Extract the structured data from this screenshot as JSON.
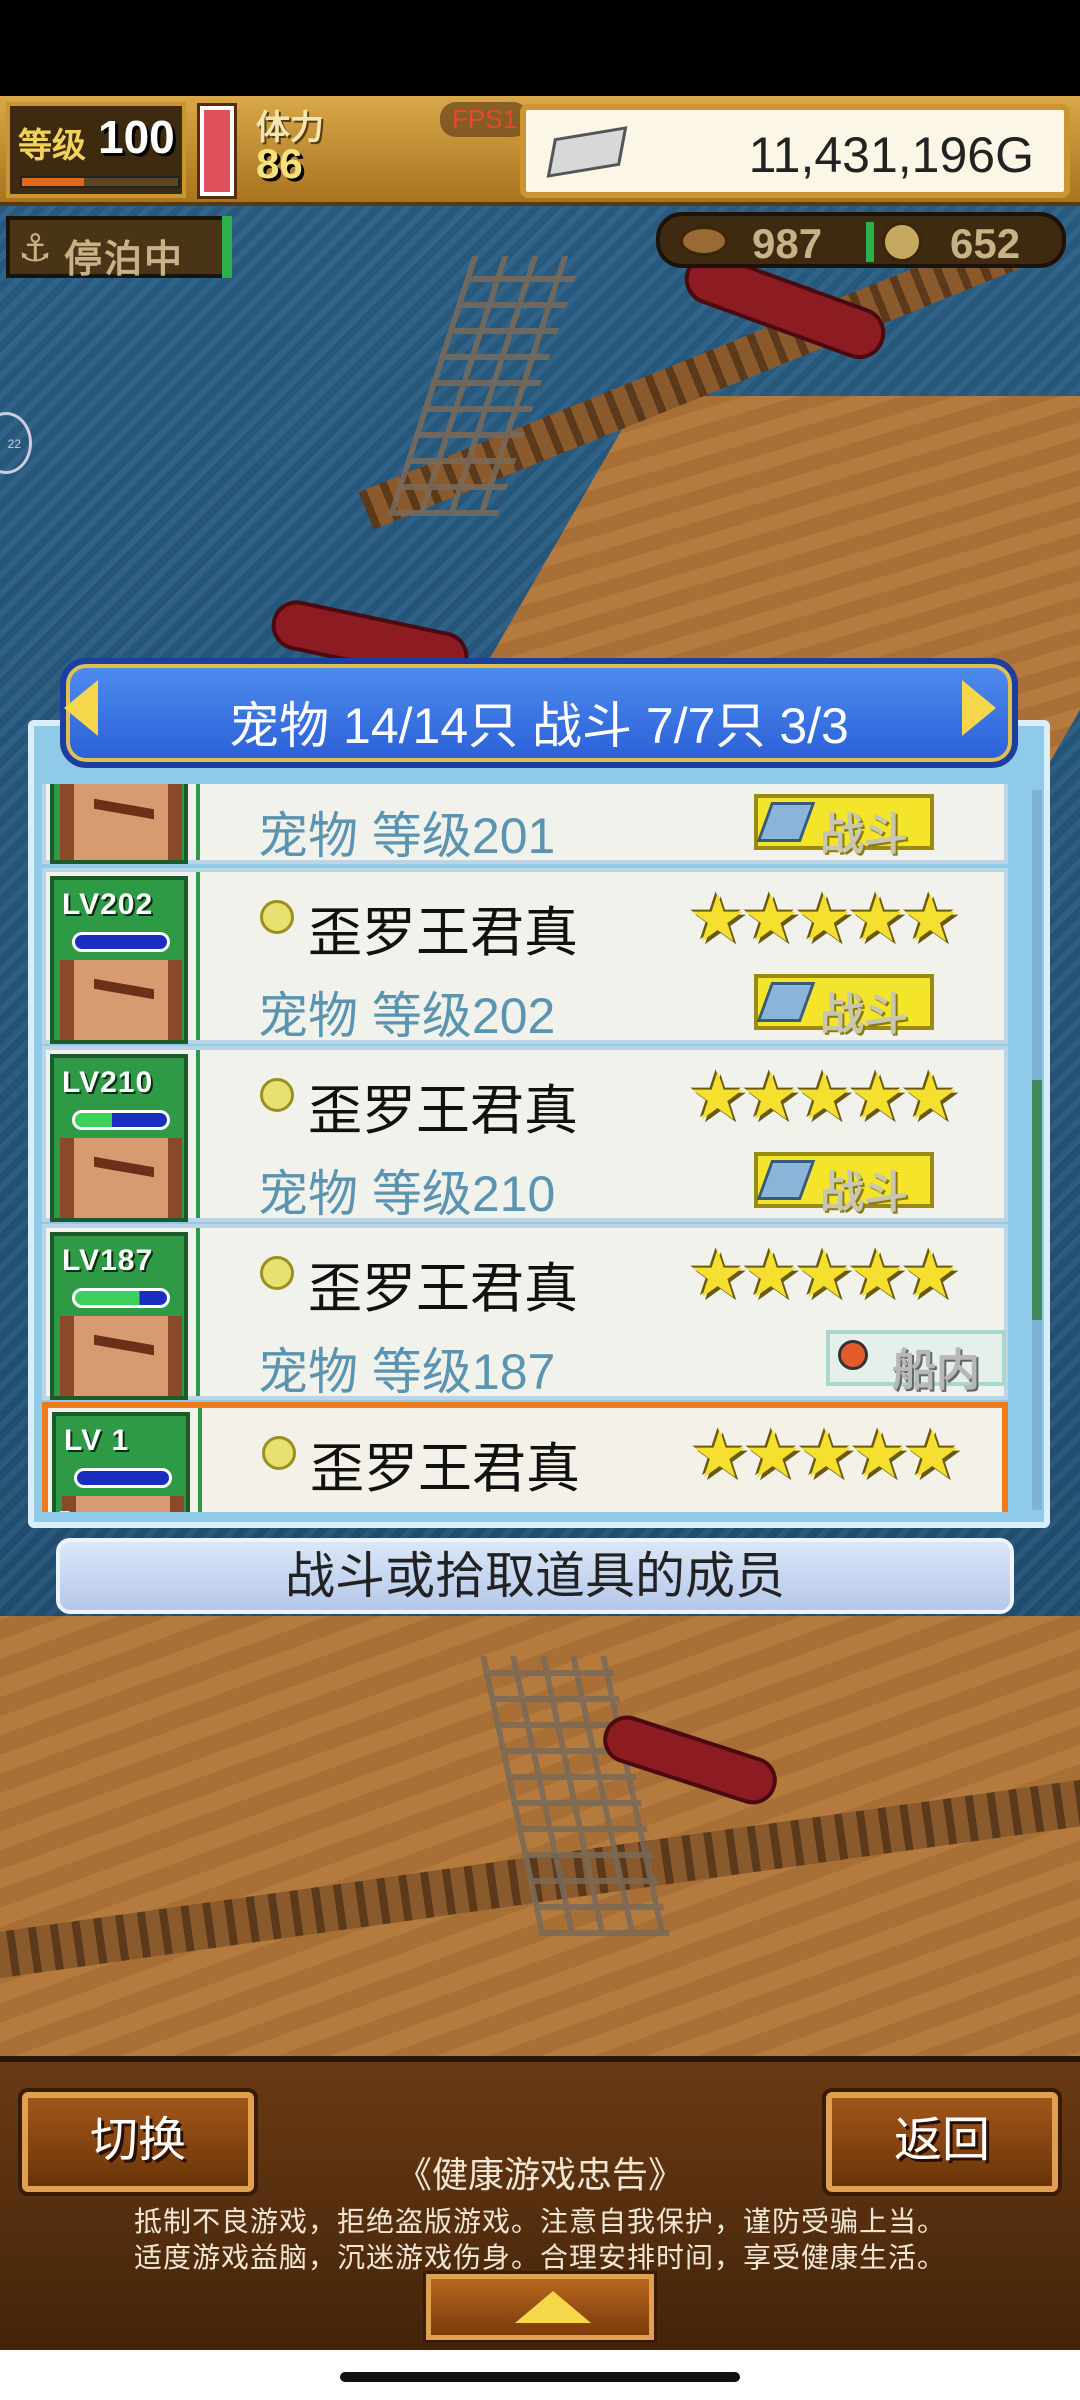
{
  "hud": {
    "level_label": "等级",
    "level_value": "100",
    "exp_fraction": 0.4,
    "stamina_label": "体力",
    "stamina_value": "86",
    "fps_label": "FPS1",
    "gold": "11,431,196G",
    "anchor_status": "停泊中",
    "wood_count": "987",
    "coin_count": "652",
    "side_bubble": "22"
  },
  "panel": {
    "title": "宠物 14/14只 战斗 7/7只  3/3",
    "rows": [
      {
        "level_badge": "",
        "name": "",
        "stars": "",
        "info": "宠物 等级201",
        "badge": "战斗",
        "badge_type": "battle"
      },
      {
        "level_badge": "LV202",
        "name": "歪罗王君真",
        "stars": "★★★★★",
        "info": "宠物 等级202",
        "badge": "战斗",
        "badge_type": "battle"
      },
      {
        "level_badge": "LV210",
        "name": "歪罗王君真",
        "stars": "★★★★★",
        "info": "宠物 等级210",
        "badge": "战斗",
        "badge_type": "battle"
      },
      {
        "level_badge": "LV187",
        "name": "歪罗王君真",
        "stars": "★★★★★",
        "info": "宠物 等级187",
        "badge": "船内",
        "badge_type": "ship"
      },
      {
        "level_badge": "LV  1",
        "name": "歪罗王君真",
        "stars": "★★★★★",
        "info": "",
        "badge": "",
        "badge_type": "none"
      }
    ],
    "hint": "战斗或拾取道具的成员"
  },
  "bottom": {
    "switch_label": "切换",
    "back_label": "返回",
    "warning_title": "《健康游戏忠告》",
    "warning_line1": "抵制不良游戏，拒绝盗版游戏。注意自我保护，谨防受骗上当。",
    "warning_line2": "适度游戏益脑，沉迷游戏伤身。合理安排时间，享受健康生活。"
  },
  "colors": {
    "accent_blue": "#2a5fd6",
    "selected_border": "#f07a18",
    "star": "#f5e030",
    "battle_badge": "#f5e52a"
  },
  "icons": [
    "silver-bar-icon",
    "anchor-icon",
    "wood-log-icon",
    "coin-icon",
    "sword-icon",
    "magnifier-icon",
    "gem-icon",
    "pointing-hand-icon",
    "up-arrow-icon"
  ]
}
